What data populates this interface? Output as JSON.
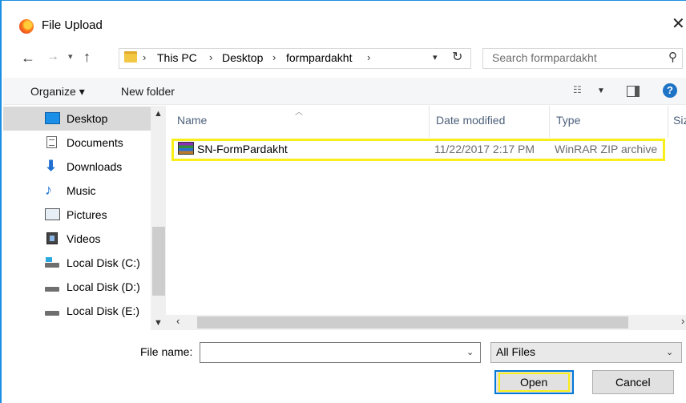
{
  "window": {
    "title": "File Upload"
  },
  "address": {
    "crumbs": [
      "This PC",
      "Desktop",
      "formpardakht"
    ],
    "search_placeholder": "Search formpardakht"
  },
  "toolbar": {
    "organize": "Organize ▾",
    "new_folder": "New folder"
  },
  "sidebar": {
    "items": [
      {
        "label": "Desktop",
        "icon": "desktop-icon",
        "selected": true
      },
      {
        "label": "Documents",
        "icon": "documents-icon"
      },
      {
        "label": "Downloads",
        "icon": "downloads-icon"
      },
      {
        "label": "Music",
        "icon": "music-icon"
      },
      {
        "label": "Pictures",
        "icon": "pictures-icon"
      },
      {
        "label": "Videos",
        "icon": "videos-icon"
      },
      {
        "label": "Local Disk (C:)",
        "icon": "local-disk-c-icon"
      },
      {
        "label": "Local Disk (D:)",
        "icon": "local-disk-d-icon"
      },
      {
        "label": "Local Disk (E:)",
        "icon": "local-disk-e-icon"
      }
    ]
  },
  "list": {
    "columns": [
      "Name",
      "Date modified",
      "Type",
      "Siz"
    ],
    "files": [
      {
        "name": "SN-FormPardakht",
        "date": "11/22/2017 2:17 PM",
        "type": "WinRAR ZIP archive",
        "icon": "winrar-archive-icon"
      }
    ]
  },
  "footer": {
    "file_name_label": "File name:",
    "file_name_value": "",
    "filter": "All Files",
    "open_label": "Open",
    "cancel_label": "Cancel"
  },
  "colors": {
    "accent": "#0078d7",
    "highlight": "#f8ee1a",
    "selection": "#d9d9d9"
  }
}
